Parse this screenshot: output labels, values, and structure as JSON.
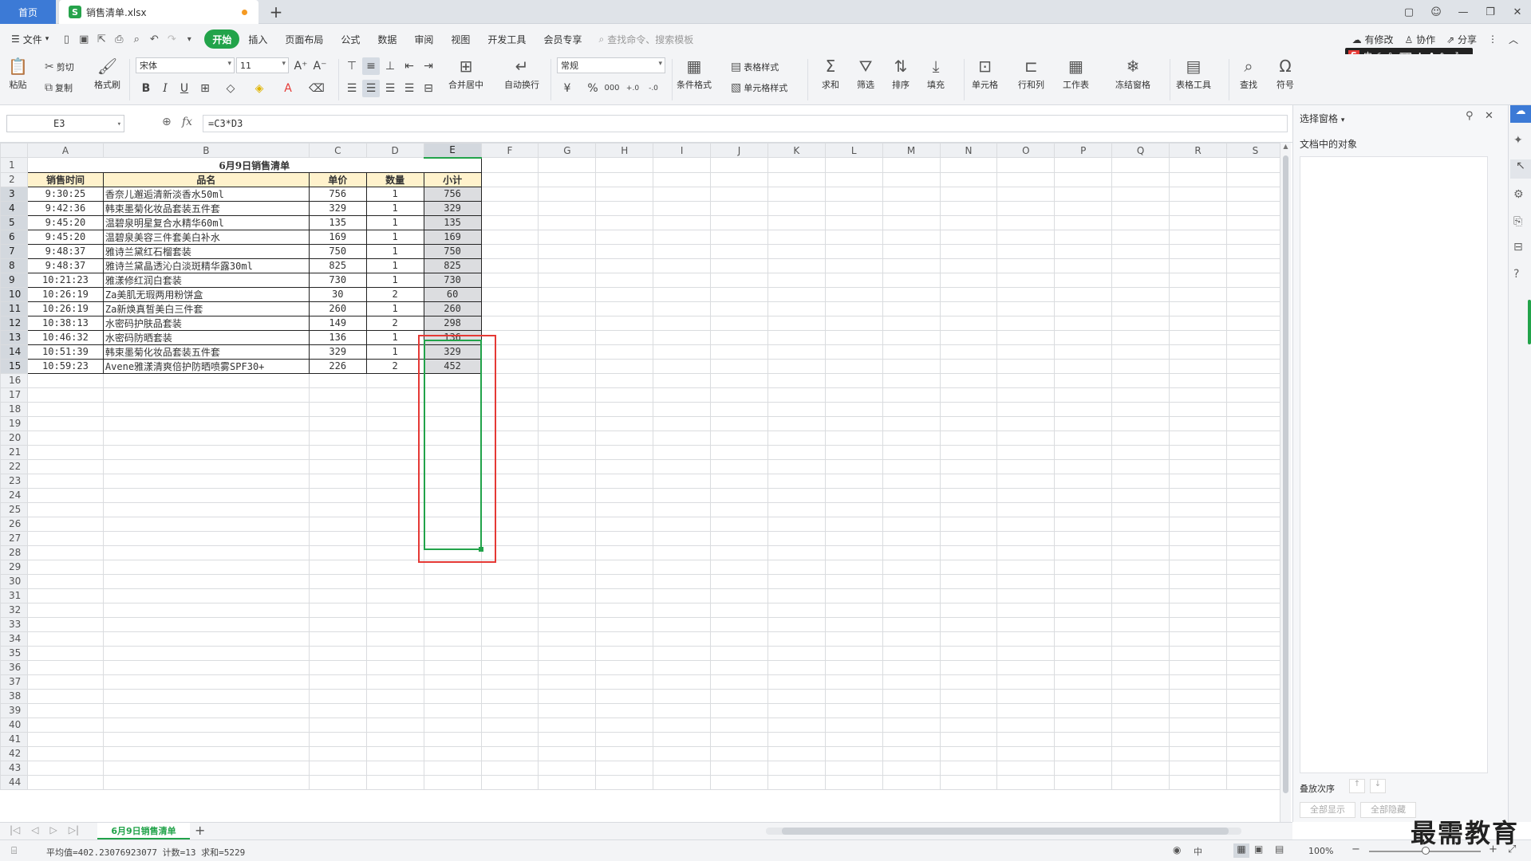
{
  "titlebar": {
    "home_tab": "首页",
    "file_tab": "销售清单.xlsx",
    "file_icon": "S",
    "new_tab": "+"
  },
  "menubar": {
    "file": "文件",
    "items": [
      "开始",
      "插入",
      "页面布局",
      "公式",
      "数据",
      "审阅",
      "视图",
      "开发工具",
      "会员专享"
    ],
    "search_placeholder": "查找命令、搜索模板",
    "right": [
      "有修改",
      "协作",
      "分享"
    ]
  },
  "ribbon": {
    "paste": "粘贴",
    "cut": "剪切",
    "copy": "复制",
    "format_painter": "格式刷",
    "font_name": "宋体",
    "font_size": "11",
    "number_format": "常规",
    "merge_center": "合并居中",
    "wrap": "自动换行",
    "cond_format": "条件格式",
    "table_style": "表格样式",
    "cell_style": "单元格样式",
    "sum": "求和",
    "filter": "筛选",
    "sort": "排序",
    "fill": "填充",
    "cell": "单元格",
    "row_col": "行和列",
    "worksheet": "工作表",
    "freeze": "冻结窗格",
    "table_tools": "表格工具",
    "find": "查找",
    "symbol": "符号"
  },
  "formula_bar": {
    "cell_ref": "E3",
    "fx": "fx",
    "formula": "=C3*D3"
  },
  "columns": [
    "A",
    "B",
    "C",
    "D",
    "E",
    "F",
    "G",
    "H",
    "I",
    "J",
    "K",
    "L",
    "M",
    "N",
    "O",
    "P",
    "Q",
    "R",
    "S"
  ],
  "sheet": {
    "title": "6月9日销售清单",
    "headers": [
      "销售时间",
      "品名",
      "单价",
      "数量",
      "小计"
    ],
    "rows": [
      [
        "9:30:25",
        "香奈儿邂逅清新淡香水50ml",
        "756",
        "1",
        "756"
      ],
      [
        "9:42:36",
        "韩束墨菊化妆品套装五件套",
        "329",
        "1",
        "329"
      ],
      [
        "9:45:20",
        "温碧泉明星复合水精华60ml",
        "135",
        "1",
        "135"
      ],
      [
        "9:45:20",
        "温碧泉美容三件套美白补水",
        "169",
        "1",
        "169"
      ],
      [
        "9:48:37",
        "雅诗兰黛红石榴套装",
        "750",
        "1",
        "750"
      ],
      [
        "9:48:37",
        "雅诗兰黛晶透沁白淡斑精华露30ml",
        "825",
        "1",
        "825"
      ],
      [
        "10:21:23",
        "雅漾修红润白套装",
        "730",
        "1",
        "730"
      ],
      [
        "10:26:19",
        "Za美肌无瑕两用粉饼盒",
        "30",
        "2",
        "60"
      ],
      [
        "10:26:19",
        "Za新焕真皙美白三件套",
        "260",
        "1",
        "260"
      ],
      [
        "10:38:13",
        "水密码护肤品套装",
        "149",
        "2",
        "298"
      ],
      [
        "10:46:32",
        "水密码防晒套装",
        "136",
        "1",
        "136"
      ],
      [
        "10:51:39",
        "韩束墨菊化妆品套装五件套",
        "329",
        "1",
        "329"
      ],
      [
        "10:59:23",
        "Avene雅漾清爽倍护防晒喷雾SPF30+",
        "226",
        "2",
        "452"
      ]
    ]
  },
  "pane": {
    "title": "选择窗格",
    "objects_label": "文档中的对象",
    "order_label": "叠放次序",
    "show_all": "全部显示",
    "hide_all": "全部隐藏"
  },
  "sheet_tab": "6月9日销售清单",
  "status": {
    "summary": "平均值=402.23076923077  计数=13  求和=5229",
    "input_mode": "中",
    "zoom": "100%"
  },
  "watermark": "最需教育",
  "colors": {
    "accent_green": "#22a34a",
    "home_tab_blue": "#3c7ad6",
    "header_fill": "#fff2cc",
    "highlight_red": "#e53935"
  }
}
